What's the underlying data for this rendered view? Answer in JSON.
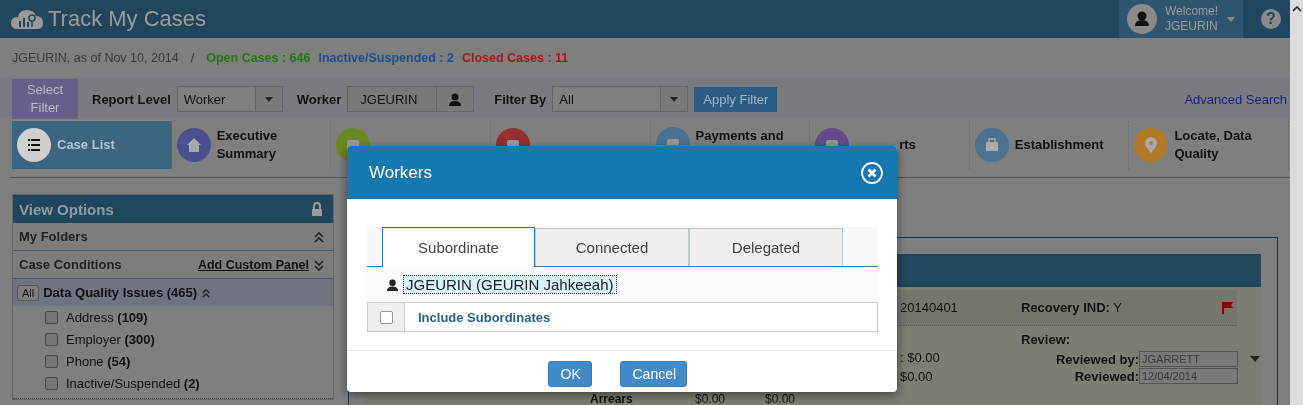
{
  "app": {
    "title": "Track My Cases",
    "help": "?"
  },
  "user": {
    "greeting": "Welcome!",
    "name": "JGEURIN"
  },
  "summary": {
    "as_of": "JGEURIN, as of Nov 10, 2014",
    "separator": "/",
    "counts": [
      {
        "text": "Open Cases : 646",
        "color": "#237a12"
      },
      {
        "text": "Inactive/Suspended : 2",
        "color": "#1d4e8c"
      },
      {
        "text": "Closed Cases : 11",
        "color": "#a01c1c"
      }
    ]
  },
  "filter_bar": {
    "select_filter": "Select Filter",
    "report_level": {
      "label": "Report Level",
      "value": "Worker"
    },
    "worker": {
      "label": "Worker",
      "value": "JGEURIN"
    },
    "filter_by": {
      "label": "Filter By",
      "value": "All"
    },
    "apply": "Apply Filter",
    "advanced_search": "Advanced Search"
  },
  "nav": [
    {
      "label": "Case List",
      "selected": true,
      "color": "#cfcfcf"
    },
    {
      "label": "Executive Summary",
      "selected": false,
      "color": "#4c4f8e"
    },
    {
      "selected": false,
      "color": "#6b8a1e"
    },
    {
      "selected": false,
      "color": "#962f2f"
    },
    {
      "label": "Payments and",
      "selected": false,
      "color": "#4c7191"
    },
    {
      "label": "rts",
      "selected": false,
      "color": "#624c8c"
    },
    {
      "label": "Establishment",
      "selected": false,
      "color": "#4d7392"
    },
    {
      "label": "Locate, Data Quality",
      "selected": false,
      "color": "#b07a28"
    }
  ],
  "sidebar": {
    "title": "View Options",
    "sections": [
      {
        "label": "My Folders",
        "expanded": true
      },
      {
        "label": "Case Conditions",
        "link": "Add Custom Panel",
        "expanded": false
      }
    ],
    "group": {
      "all": "All",
      "label": "Data Quality Issues",
      "count": "(465)",
      "expanded": true,
      "items": [
        {
          "label": "Address",
          "count": "(109)",
          "checked": false
        },
        {
          "label": "Employer",
          "count": "(300)",
          "checked": false
        },
        {
          "label": "Phone",
          "count": "(54)",
          "checked": false
        },
        {
          "label": "Inactive/Suspended",
          "count": "(2)",
          "checked": false
        }
      ]
    }
  },
  "case_card": {
    "id_fragment": "20140401",
    "recovery": {
      "label": "Recovery IND:",
      "value": "Y"
    },
    "flagged": true,
    "amounts": [
      ": $0.00",
      "$0.00"
    ],
    "review": {
      "title": "Review:",
      "reviewed_by": {
        "label": "Reviewed by:",
        "value": "JGARRETT"
      },
      "reviewed": {
        "label": "Reviewed:",
        "value": "12/04/2014"
      }
    },
    "arrears": {
      "label": "Arrears",
      "values": [
        "$0.00",
        "$0.00"
      ]
    }
  },
  "dialog": {
    "title": "Workers",
    "tabs": [
      {
        "label": "Subordinate",
        "selected": true
      },
      {
        "label": "Connected",
        "selected": false
      },
      {
        "label": "Delegated",
        "selected": false
      }
    ],
    "worker": "JGEURIN (GEURIN Jahkeeah)",
    "include": {
      "label": "Include Subordinates",
      "checked": false
    },
    "buttons": [
      {
        "label": "OK"
      },
      {
        "label": "Cancel"
      }
    ]
  }
}
